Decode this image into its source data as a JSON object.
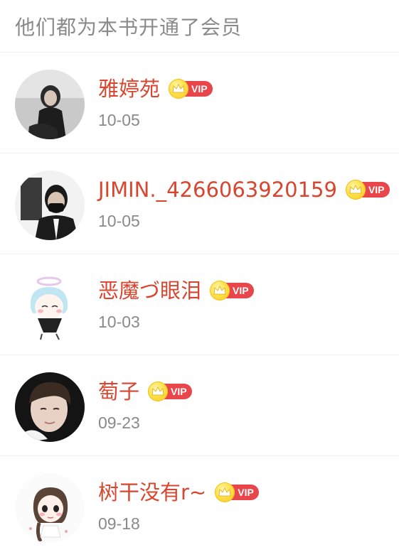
{
  "header": {
    "title": "他们都为本书开通了会员"
  },
  "members": [
    {
      "name": "雅婷苑",
      "date": "10-05",
      "badge": "VIP",
      "avatar": "avatar-photo-woman-dark"
    },
    {
      "name": "JIMIN._4266063920159",
      "date": "10-05",
      "badge": "VIP",
      "avatar": "avatar-photo-man-mask"
    },
    {
      "name": "恶魔づ眼泪",
      "date": "10-03",
      "badge": "VIP",
      "avatar": "avatar-cartoon-angel"
    },
    {
      "name": "萄子",
      "date": "09-23",
      "badge": "VIP",
      "avatar": "avatar-photo-boy"
    },
    {
      "name": "树干没有r~",
      "date": "09-18",
      "badge": "VIP",
      "avatar": "avatar-cartoon-girl"
    }
  ],
  "colors": {
    "name": "#d9462f",
    "vip_badge": "#e8464a",
    "crown": "#ffe14d",
    "meta_text": "#8a8a8a"
  }
}
